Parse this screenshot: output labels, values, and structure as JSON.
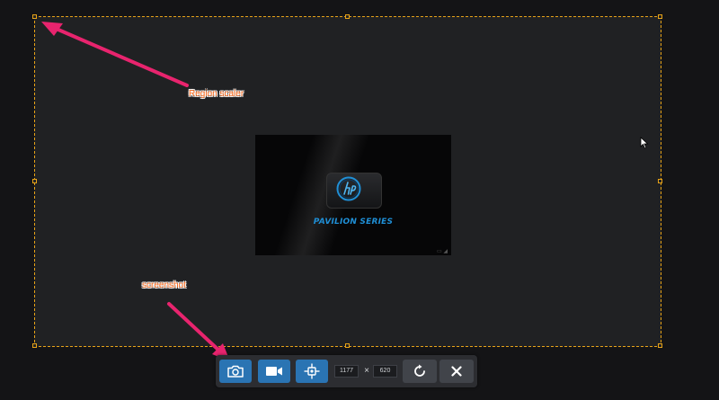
{
  "annotations": {
    "region_scaler": "Region scaler",
    "screenshot": "screenshot"
  },
  "preview": {
    "brand_text": "PAVILION SERIES",
    "logo_icon": "hp-logo-icon"
  },
  "toolbar": {
    "screenshot_icon": "camera-icon",
    "record_icon": "video-camera-icon",
    "target_icon": "crosshair-icon",
    "width_value": "1177",
    "separator": "×",
    "height_value": "620",
    "reset_icon": "rotate-icon",
    "close_icon": "close-icon"
  },
  "colors": {
    "selection_border": "#e8a317",
    "button_blue": "#2a74b3",
    "annotation_text": "#ff6a1a",
    "arrow": "#e8246e"
  }
}
